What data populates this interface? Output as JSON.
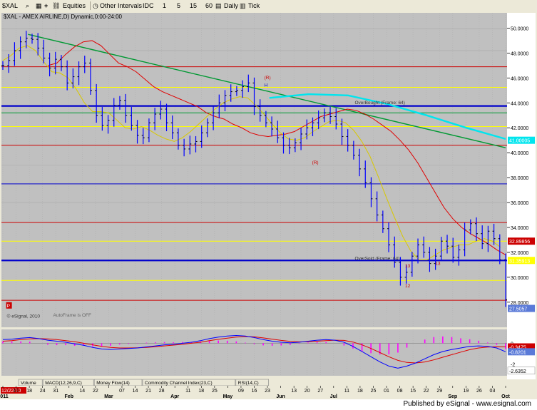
{
  "toolbar": {
    "symbol": "$XAL",
    "equities_label": "Equities",
    "other_intervals_label": "Other Intervals",
    "idc_label": "IDC",
    "i1": "1",
    "i5": "5",
    "i15": "15",
    "i60": "60",
    "daily_label": "Daily",
    "tick_label": "Tick"
  },
  "chart_header": "$XAL - AMEX AIRLINE,D) Dynamic,0:00-24:00",
  "colors": {
    "bg": "#c0c0c0",
    "grid": "#a8a8a8",
    "price": "#0000ff",
    "blue_line": "#0000cc",
    "red_line": "#cc0000",
    "yellow_line": "#ffff00",
    "green_line": "#009933",
    "ma_red": "#e00000",
    "ma_yellow": "#d8c800",
    "cyan": "#00e5ee",
    "macd_hist": "#ff00ff",
    "macd_signal": "#e00000",
    "macd_line": "#0000ff"
  },
  "chart_data": [
    {
      "type": "line",
      "title": "$XAL - AMEX AIRLINE, Daily",
      "x_labels": [
        "2011",
        "10",
        "18",
        "24",
        "31",
        "Feb",
        "14",
        "22",
        "Mar",
        "14",
        "21",
        "28",
        "Apr",
        "11",
        "18",
        "25",
        "May",
        "09",
        "16",
        "23",
        "Jun",
        "13",
        "20",
        "27",
        "Jul",
        "11",
        "18",
        "25",
        "Aug",
        "08",
        "15",
        "22",
        "29",
        "Sep",
        "19",
        "26",
        "Oct"
      ],
      "x_axis_text": [
        "2011",
        "10",
        "18",
        "24",
        "31",
        "Feb",
        "14",
        "22",
        "Mar",
        "07",
        "14",
        "21",
        "28",
        "Apr",
        "11",
        "18",
        "25",
        "May",
        "09",
        "16",
        "23",
        "Jun",
        "13",
        "20",
        "27",
        "Jul",
        "11",
        "18",
        "25",
        "01",
        "08",
        "15",
        "22",
        "29",
        "Sep",
        "19",
        "26",
        "03",
        "Oct"
      ],
      "ylim": [
        26.5,
        51.0
      ],
      "y_ticks": [
        "50.0000",
        "48.0000",
        "46.0000",
        "44.0000",
        "42.0000",
        "40.0000",
        "38.0000",
        "36.0000",
        "34.0000",
        "32.0000",
        "30.0000",
        "28.0000"
      ],
      "series": [
        {
          "name": "Close",
          "values": [
            47.0,
            47.4,
            48.2,
            48.9,
            49.2,
            49.1,
            48.4,
            47.6,
            46.8,
            47.5,
            46.9,
            45.6,
            46.1,
            46.9,
            47.2,
            45.0,
            43.0,
            42.2,
            42.6,
            43.8,
            44.2,
            43.0,
            42.2,
            41.4,
            41.2,
            42.4,
            43.1,
            43.5,
            42.4,
            41.6,
            40.6,
            40.3,
            40.7,
            40.9,
            41.6,
            42.4,
            43.2,
            44.0,
            44.6,
            44.9,
            45.0,
            45.3,
            45.6,
            43.7,
            43.0,
            42.4,
            41.9,
            41.2,
            40.6,
            40.4,
            40.8,
            41.5,
            42.0,
            42.4,
            42.8,
            43.2,
            42.9,
            42.3,
            41.3,
            40.6,
            39.8,
            38.7,
            37.6,
            36.3,
            35.0,
            33.9,
            32.6,
            31.2,
            30.0,
            30.4,
            31.7,
            32.6,
            32.0,
            31.1,
            31.7,
            32.9,
            32.5,
            31.6,
            32.2,
            33.8,
            34.3,
            33.5,
            32.7,
            33.7,
            33.1,
            31.4,
            28.2
          ],
          "color": "#0000ff"
        },
        {
          "name": "MA slow",
          "values": [
            47.0,
            47.2,
            47.9,
            48.5,
            48.9,
            49.0,
            48.6,
            47.9,
            47.2,
            46.9,
            46.5,
            45.9,
            45.3,
            44.9,
            44.6,
            44.3,
            44.0,
            43.7,
            43.2,
            42.9,
            42.7,
            42.3,
            42.0,
            41.6,
            41.4,
            41.3,
            41.4,
            41.5,
            41.7,
            42.1,
            42.5,
            42.9,
            43.1,
            43.3,
            43.5,
            43.4,
            43.1,
            42.7,
            42.2,
            41.7,
            41.0,
            40.2,
            39.2,
            38.0,
            36.8,
            35.6,
            34.7,
            34.0,
            33.5,
            33.1,
            32.7,
            32.2,
            31.8
          ],
          "color": "#e00000"
        },
        {
          "name": "MA fast",
          "values": [
            47.4,
            47.8,
            48.4,
            48.6,
            48.2,
            47.3,
            46.5,
            46.4,
            46.0,
            45.1,
            44.0,
            43.3,
            43.3,
            43.2,
            42.6,
            42.0,
            41.9,
            42.1,
            41.8,
            41.4,
            41.1,
            40.9,
            41.2,
            41.7,
            42.3,
            42.9,
            43.5,
            44.0,
            44.3,
            44.5,
            44.4,
            43.8,
            43.1,
            42.3,
            41.6,
            41.1,
            41.0,
            41.2,
            41.7,
            42.1,
            42.5,
            42.6,
            42.4,
            41.8,
            40.9,
            39.7,
            38.1,
            36.4,
            34.8,
            33.3,
            32.1,
            31.4,
            31.4,
            31.8,
            32.2,
            32.4,
            32.6,
            32.6,
            32.9,
            33.1,
            32.9,
            32.4
          ],
          "color": "#d8c800"
        },
        {
          "name": "Trend",
          "values": [
            49.5,
            40.4
          ],
          "color": "#009933"
        },
        {
          "name": "Cyan",
          "values": [
            44.4,
            44.7,
            44.6,
            43.9,
            43.0,
            42.0,
            41.1
          ],
          "color": "#00e5ee"
        }
      ],
      "levels": [
        {
          "value": 49.95,
          "color": "#a8a8a8"
        },
        {
          "value": 48.2,
          "color": "#a8a8a8"
        },
        {
          "value": 46.9,
          "color": "#cc0000"
        },
        {
          "value": 45.25,
          "color": "#ffff00"
        },
        {
          "value": 43.75,
          "color": "#0000cc"
        },
        {
          "value": 43.2,
          "color": "#009933"
        },
        {
          "value": 42.1,
          "color": "#ffff00"
        },
        {
          "value": 40.6,
          "color": "#cc0000"
        },
        {
          "value": 39.0,
          "color": "#a8a8a8"
        },
        {
          "value": 37.5,
          "color": "#0000cc"
        },
        {
          "value": 36.0,
          "color": "#a8a8a8"
        },
        {
          "value": 34.4,
          "color": "#cc0000"
        },
        {
          "value": 32.9,
          "color": "#ffff00"
        },
        {
          "value": 31.35,
          "color": "#0000cc"
        },
        {
          "value": 29.75,
          "color": "#ffff00"
        },
        {
          "value": 28.15,
          "color": "#cc0000"
        }
      ],
      "price_labels": [
        {
          "text": "41.00005",
          "value": 41.0,
          "color": "#00e5ee"
        },
        {
          "text": "32.89856",
          "value": 32.9,
          "color": "#cc0000"
        },
        {
          "text": "31.35913",
          "value": 31.35,
          "color": "#ffff00"
        },
        {
          "text": "27.5057",
          "value": 27.5,
          "color": "#5a7ad8"
        }
      ],
      "annotations": [
        {
          "text": "OverBought (Frame: 64)",
          "value": 43.9
        },
        {
          "text": "OverSold (Frame: 64)",
          "value": 31.4
        },
        {
          "text": "(R)",
          "value": 45.9
        },
        {
          "text": "H",
          "value": 45.3
        },
        {
          "text": "(R)",
          "value": 39.1
        },
        {
          "text": "13",
          "value": 31.0
        },
        {
          "text": "13",
          "value": 30.8
        },
        {
          "text": "12",
          "value": 29.2
        },
        {
          "text": "AutoFrame is OFF",
          "value": 26.85
        },
        {
          "text": "P",
          "value": 27.6
        },
        {
          "text": "© eSignal, 2010",
          "value": 26.75
        }
      ]
    },
    {
      "type": "line",
      "title": "MACD(12,26,9,C)",
      "ylim": [
        -3,
        1.2
      ],
      "y_ticks": [
        "0",
        "-2"
      ],
      "series": [
        {
          "name": "MACD",
          "values": [
            0.35,
            0.4,
            0.5,
            0.55,
            0.45,
            0.3,
            0.2,
            0.1,
            -0.05,
            -0.2,
            -0.4,
            -0.55,
            -0.6,
            -0.55,
            -0.5,
            -0.45,
            -0.35,
            -0.25,
            -0.15,
            -0.1,
            0.0,
            0.1,
            0.25,
            0.45,
            0.6,
            0.7,
            0.75,
            0.7,
            0.55,
            0.35,
            0.2,
            0.1,
            0.05,
            0.1,
            0.2,
            0.3,
            0.35,
            0.3,
            0.1,
            -0.3,
            -0.8,
            -1.3,
            -1.8,
            -2.2,
            -2.4,
            -2.2,
            -1.9,
            -1.5,
            -1.1,
            -0.8,
            -0.6,
            -0.45,
            -0.3,
            -0.25,
            -0.3,
            -0.45,
            -0.82
          ],
          "color": "#0000ff"
        },
        {
          "name": "Signal",
          "values": [
            0.2,
            0.25,
            0.35,
            0.42,
            0.45,
            0.42,
            0.35,
            0.25,
            0.15,
            0.0,
            -0.15,
            -0.3,
            -0.4,
            -0.45,
            -0.45,
            -0.43,
            -0.4,
            -0.33,
            -0.25,
            -0.18,
            -0.1,
            0.0,
            0.1,
            0.25,
            0.38,
            0.5,
            0.6,
            0.65,
            0.62,
            0.52,
            0.4,
            0.28,
            0.18,
            0.14,
            0.15,
            0.2,
            0.26,
            0.3,
            0.28,
            0.12,
            -0.15,
            -0.5,
            -0.9,
            -1.3,
            -1.65,
            -1.85,
            -1.9,
            -1.8,
            -1.6,
            -1.35,
            -1.1,
            -0.85,
            -0.62,
            -0.45,
            -0.36,
            -0.33,
            -0.35
          ],
          "color": "#e00000"
        }
      ],
      "price_labels": [
        {
          "text": "-0.3475",
          "value": -0.35,
          "color": "#cc0000"
        },
        {
          "text": "-0.8201",
          "value": -0.82,
          "color": "#5a7ad8"
        },
        {
          "text": "-2.6352",
          "value": -2.64,
          "color": "#c0c0c0"
        }
      ]
    }
  ],
  "panel_tabs": [
    "Volume",
    "MACD(12,26,9,C)",
    "Money Flow(14)",
    "Commodity Channel Index(23,C)",
    "RSI(14,C)"
  ],
  "date_badge": "12/22/10",
  "footer_text": "Published by eSignal - www.esignal.com"
}
